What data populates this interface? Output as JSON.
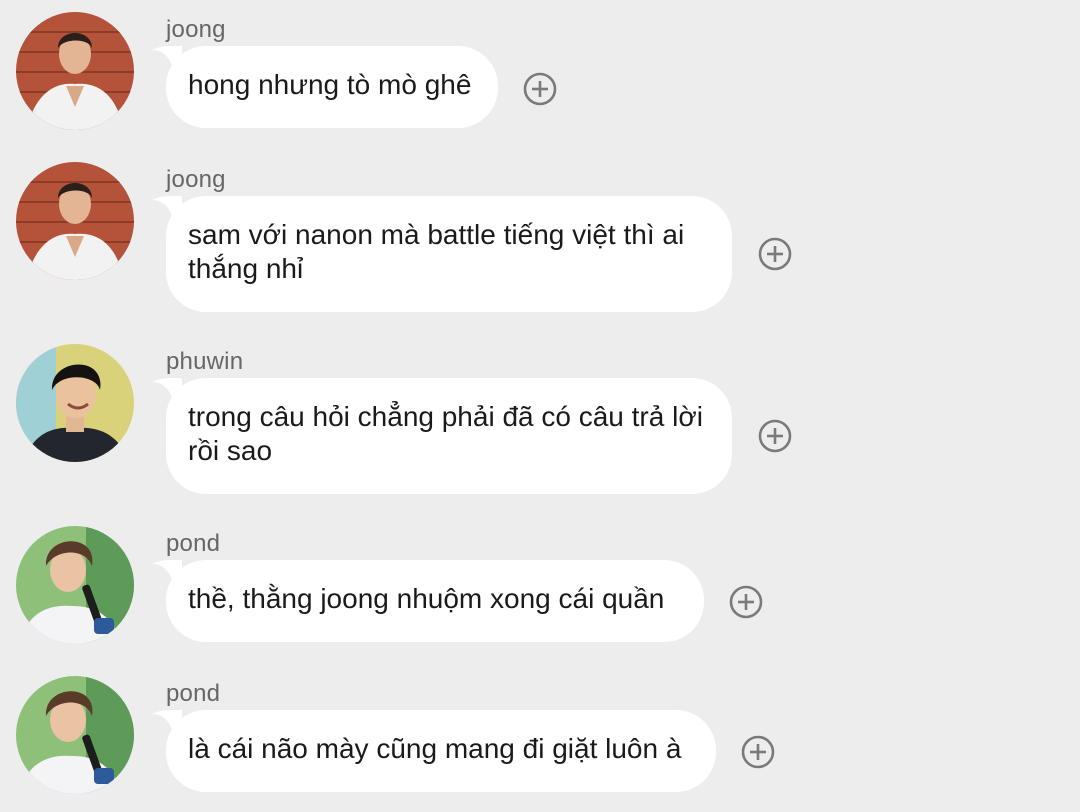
{
  "colors": {
    "background": "#ededed",
    "bubble": "#ffffff",
    "text": "#1a1a1a",
    "sender": "#666666",
    "icon": "#7a7a7a"
  },
  "messages": [
    {
      "sender": "joong",
      "text": "hong nhưng tò mò ghê",
      "avatar": "avatar-joong",
      "action_icon": "add-reaction-icon"
    },
    {
      "sender": "joong",
      "text": "sam với nanon mà battle tiếng việt thì ai thắng nhỉ",
      "avatar": "avatar-joong",
      "action_icon": "add-reaction-icon"
    },
    {
      "sender": "phuwin",
      "text": "trong câu hỏi chẳng phải đã có câu trả lời rồi sao",
      "avatar": "avatar-phuwin",
      "action_icon": "add-reaction-icon"
    },
    {
      "sender": "pond",
      "text": "thề, thằng joong nhuộm xong cái quần",
      "avatar": "avatar-pond",
      "action_icon": "add-reaction-icon"
    },
    {
      "sender": "pond",
      "text": "là cái não mày cũng mang đi giặt luôn à",
      "avatar": "avatar-pond",
      "action_icon": "add-reaction-icon"
    }
  ]
}
